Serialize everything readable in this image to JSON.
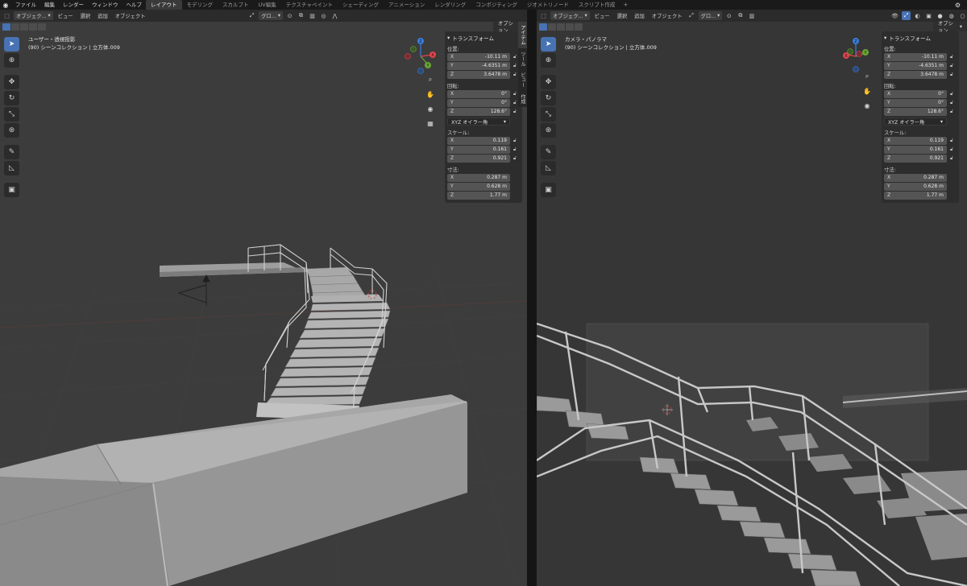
{
  "menubar": {
    "items": [
      "ファイル",
      "編集",
      "レンダー",
      "ウィンドウ",
      "ヘルプ"
    ],
    "tabs": [
      "レイアウト",
      "モデリング",
      "スカルプト",
      "UV編集",
      "テクスチャペイント",
      "シェーディング",
      "アニメーション",
      "レンダリング",
      "コンポジティング",
      "ジオメトリノード",
      "スクリプト作成"
    ],
    "active_tab": "レイアウト",
    "add_tab": "+"
  },
  "left_viewport": {
    "header": {
      "mode": "オブジェク...",
      "menus": [
        "ビュー",
        "選択",
        "追加",
        "オブジェクト"
      ],
      "orientation": "グロ..."
    },
    "options": "オプション",
    "view_name": "ユーザー・透視投影",
    "collection": "(90) シーンコレクション | 立方体.009",
    "tabs": [
      "アイテム",
      "ツール",
      "ビュー",
      "作成"
    ],
    "active_vtab": "アイテム"
  },
  "right_viewport": {
    "header": {
      "mode": "オブジェク...",
      "menus": [
        "ビュー",
        "選択",
        "追加",
        "オブジェクト"
      ],
      "orientation": "グロ..."
    },
    "options": "オプション",
    "view_name": "カメラ・パノラマ",
    "collection": "(90) シーンコレクション | 立方体.009"
  },
  "transform": {
    "title": "トランスフォーム",
    "location_label": "位置:",
    "location": [
      [
        "X",
        "-10.11 m"
      ],
      [
        "Y",
        "-4.6351 m"
      ],
      [
        "Z",
        "3.6478 m"
      ]
    ],
    "rotation_label": "回転:",
    "rotation": [
      [
        "X",
        "0°"
      ],
      [
        "Y",
        "0°"
      ],
      [
        "Z",
        "128.6°"
      ]
    ],
    "rotation_mode": "XYZ オイラー角",
    "scale_label": "スケール:",
    "scale": [
      [
        "X",
        "0.119"
      ],
      [
        "Y",
        "0.161"
      ],
      [
        "Z",
        "0.921"
      ]
    ],
    "dimensions_label": "寸法:",
    "dimensions": [
      [
        "X",
        "0.287 m"
      ],
      [
        "Y",
        "0.628 m"
      ],
      [
        "Z",
        "1.77 m"
      ]
    ]
  },
  "gizmo": {
    "x": "X",
    "y": "Y",
    "z": "Z"
  },
  "colors": {
    "accent": "#4772b3",
    "viewport_bg": "#3c3c3c",
    "header_bg": "#2b2b2b",
    "panel_bg": "#2d2d2d",
    "field_bg": "#545454",
    "axis_x": "#e2444c",
    "axis_y": "#6aa533",
    "axis_z": "#3a7fe0"
  },
  "icons": {
    "toolbar": [
      "cursor-select-icon",
      "cursor-3d-icon",
      "move-icon",
      "rotate-icon",
      "scale-icon",
      "transform-icon",
      "annotate-icon",
      "measure-icon",
      "add-cube-icon"
    ],
    "nav": [
      "zoom-icon",
      "hand-pan-icon",
      "camera-view-icon",
      "grid-persp-icon"
    ]
  }
}
